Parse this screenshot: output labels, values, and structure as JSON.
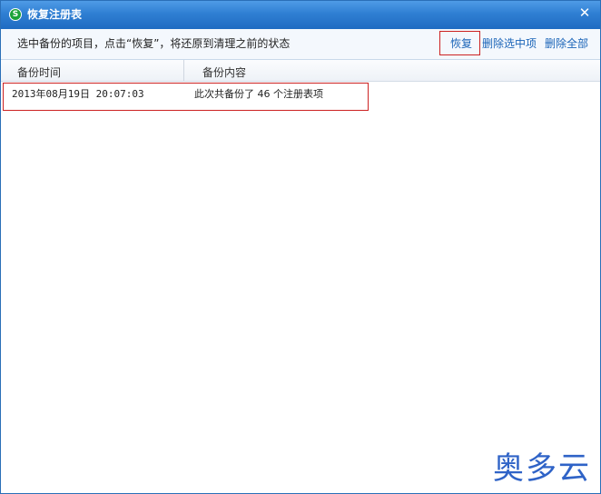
{
  "window": {
    "title": "恢复注册表",
    "app_icon_glyph": "S",
    "app_icon_color": "#1aa238",
    "close_glyph": "✕",
    "titlebar_color": "#2f7fd3"
  },
  "toolbar": {
    "instruction": "选中备份的项目，点击“恢复”，将还原到清理之前的状态",
    "restore_label": "恢复",
    "delete_selected_label": "删除选中项",
    "delete_all_label": "删除全部",
    "link_color": "#1a64b8",
    "highlight_color": "#cc2222"
  },
  "table": {
    "columns": [
      "备份时间",
      "备份内容"
    ],
    "rows": [
      {
        "time": "2013年08月19日 20:07:03",
        "content": "此次共备份了 46 个注册表项"
      }
    ]
  },
  "watermark": {
    "text": "奥多云",
    "color": "#2f63c7"
  }
}
